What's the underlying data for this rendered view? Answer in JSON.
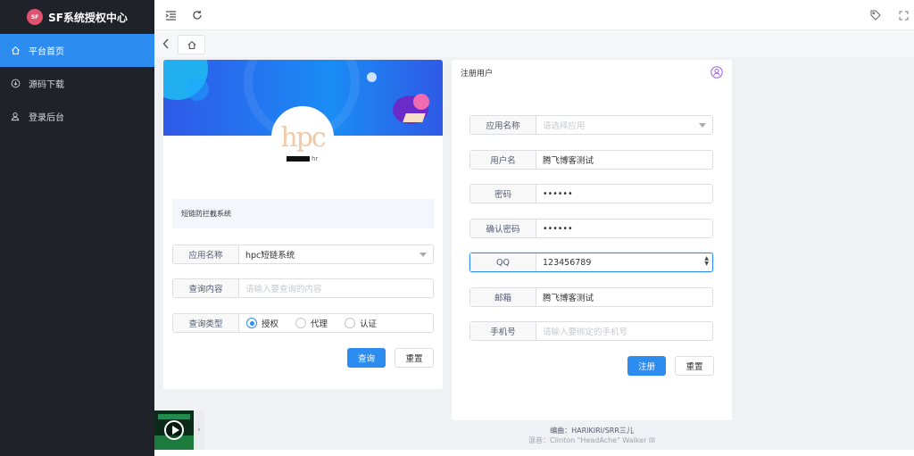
{
  "app": {
    "title": "SF系统授权中心",
    "logo_text": "SF系统"
  },
  "sidebar": {
    "items": [
      {
        "label": "平台首页",
        "icon": "home-icon",
        "active": true
      },
      {
        "label": "源码下载",
        "icon": "download-icon",
        "active": false
      },
      {
        "label": "登录后台",
        "icon": "user-icon",
        "active": false
      }
    ]
  },
  "colors": {
    "sidebar_bg": "#1f2229",
    "accent": "#2d8cf0",
    "page_bg": "#eff1f4"
  },
  "topbar": {
    "icons": [
      "menu-fold-icon",
      "refresh-icon",
      "tag-icon",
      "fullscreen-icon"
    ]
  },
  "query_card": {
    "avatar_text": "hpc",
    "owner_text": "hr",
    "description": "短链防拦截系统",
    "fields": {
      "app_name": {
        "label": "应用名称",
        "value": "hpc短链系统"
      },
      "query_content": {
        "label": "查询内容",
        "placeholder": "请输入要查询的内容"
      },
      "query_type": {
        "label": "查询类型",
        "options": [
          "授权",
          "代理",
          "认证"
        ],
        "selected": "授权"
      }
    },
    "buttons": {
      "submit": "查询",
      "reset": "重置"
    }
  },
  "register_card": {
    "title": "注册用户",
    "fields": {
      "app_name": {
        "label": "应用名称",
        "placeholder": "请选择应用"
      },
      "username": {
        "label": "用户名",
        "value": "腾飞博客测试"
      },
      "password": {
        "label": "密码",
        "value": "••••••"
      },
      "confirm_password": {
        "label": "确认密码",
        "value": "••••••"
      },
      "qq": {
        "label": "QQ",
        "value": "123456789"
      },
      "email": {
        "label": "邮箱",
        "value": "腾飞博客测试"
      },
      "phone": {
        "label": "手机号",
        "placeholder": "请输入要绑定的手机号"
      }
    },
    "buttons": {
      "submit": "注册",
      "reset": "重置"
    }
  },
  "footer": {
    "line1": "编曲：HARIKIRI/SRR三儿",
    "line2": "混音：Clinton \"HeadAche\" Walker III"
  }
}
